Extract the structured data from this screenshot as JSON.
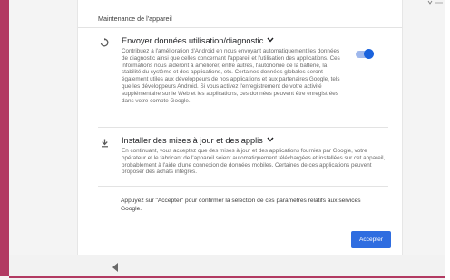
{
  "setup": {
    "section_title": "Maintenance de l'appareil",
    "usage": {
      "title": "Envoyer données utilisation/diagnostic",
      "description": "Contribuez à l'amélioration d'Android en nous envoyant automatiquement les données de diagnostic ainsi que celles concernant l'appareil et l'utilisation des applications. Ces informations nous aideront à améliorer, entre autres, l'autonomie de la batterie, la stabilité du système et des applications, etc. Certaines données globales seront également utiles aux développeurs de nos applications et aux partenaires Google, tels que les développeurs Android. Si vous activez l'enregistrement de votre activité supplémentaire sur le Web et les applications, ces données peuvent être enregistrées dans votre compte Google.",
      "toggle_on": true
    },
    "updates": {
      "title": "Installer des mises à jour et des applis",
      "description": "En continuant, vous acceptez que des mises à jour et des applications fournies par Google, votre opérateur et le fabricant de l'appareil soient automatiquement téléchargées et installées sur cet appareil, probablement à l'aide d'une connexion de données mobiles. Certaines de ces applications peuvent proposer des achats intégrés."
    },
    "accept_note": "Appuyez sur \"Accepter\" pour confirmer la sélection de ces paramètres relatifs aux services Google.",
    "accept_label": "Accepter"
  },
  "colors": {
    "accent": "#1a63dd",
    "frame": "#b23a62"
  }
}
